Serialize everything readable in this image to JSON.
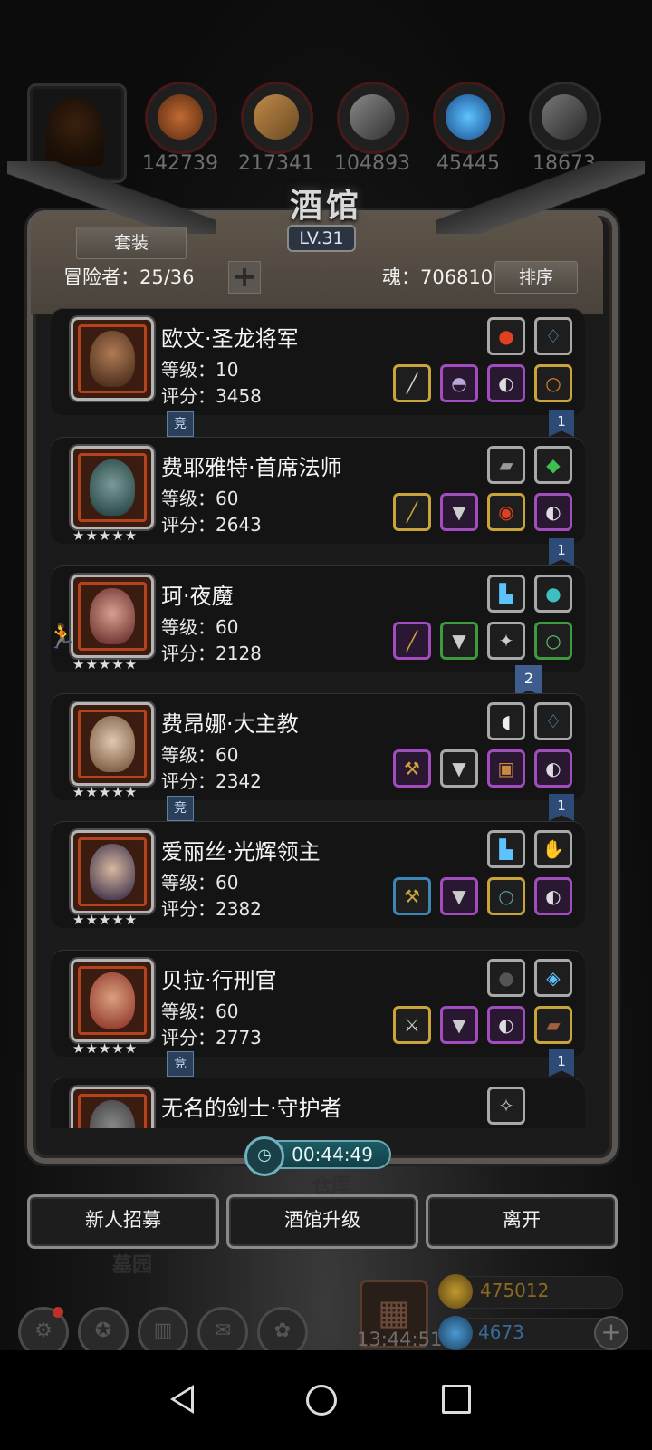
{
  "resources": {
    "values": [
      "142739",
      "217341",
      "104893",
      "45445",
      "18673"
    ],
    "colors": [
      "#a8562a",
      "#9a7040",
      "#555555",
      "#2b8ad0",
      "#474747"
    ]
  },
  "panel": {
    "title": "酒馆",
    "level": "LV.31",
    "suit_label": "套装",
    "adventurers_label": "冒险者：25/36",
    "add_label": "+",
    "soul_label": "魂：706810",
    "sort_label": "排序"
  },
  "heroes": [
    {
      "name": "欧文·圣龙将军",
      "level": "等级：10",
      "score": "评分：3458",
      "stars": ""
    },
    {
      "name": "费耶雅特·首席法师",
      "level": "等级：60",
      "score": "评分：2643",
      "stars": "★★★★★"
    },
    {
      "name": "珂·夜魔",
      "level": "等级：60",
      "score": "评分：2128",
      "stars": "★★★★★"
    },
    {
      "name": "费昂娜·大主教",
      "level": "等级：60",
      "score": "评分：2342",
      "stars": "★★★★★"
    },
    {
      "name": "爱丽丝·光辉领主",
      "level": "等级：60",
      "score": "评分：2382",
      "stars": "★★★★★"
    },
    {
      "name": "贝拉·行刑官",
      "level": "等级：60",
      "score": "评分：2773",
      "stars": "★★★★★"
    },
    {
      "name": "无名的剑士·守护者",
      "level": "",
      "score": "",
      "stars": ""
    }
  ],
  "tags": {
    "jing": "竞",
    "flag1": "1",
    "flag2": "2"
  },
  "timer": "00:44:49",
  "background_labels": {
    "warehouse": "仓库",
    "graveyard": "墓园"
  },
  "buttons": {
    "recruit": "新人招募",
    "upgrade": "酒馆升级",
    "leave": "离开"
  },
  "dock": {
    "gift_time": "13:44:51",
    "gold": "475012",
    "gems": "4673",
    "plus": "+"
  }
}
